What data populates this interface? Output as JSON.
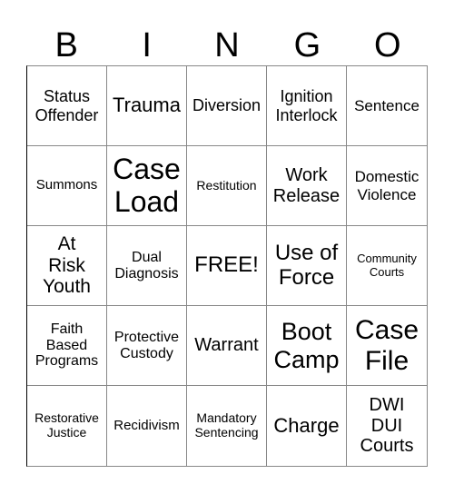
{
  "header": [
    "B",
    "I",
    "N",
    "G",
    "O"
  ],
  "cells": [
    {
      "text": "Status\nOffender",
      "size": 18
    },
    {
      "text": "Trauma",
      "size": 22
    },
    {
      "text": "Diversion",
      "size": 18
    },
    {
      "text": "Ignition\nInterlock",
      "size": 18
    },
    {
      "text": "Sentence",
      "size": 17
    },
    {
      "text": "Summons",
      "size": 15
    },
    {
      "text": "Case\nLoad",
      "size": 32
    },
    {
      "text": "Restitution",
      "size": 14
    },
    {
      "text": "Work\nRelease",
      "size": 20
    },
    {
      "text": "Domestic\nViolence",
      "size": 17
    },
    {
      "text": "At\nRisk\nYouth",
      "size": 21
    },
    {
      "text": "Dual\nDiagnosis",
      "size": 16
    },
    {
      "text": "FREE!",
      "size": 24
    },
    {
      "text": "Use of\nForce",
      "size": 24
    },
    {
      "text": "Community\nCourts",
      "size": 13
    },
    {
      "text": "Faith\nBased\nPrograms",
      "size": 16
    },
    {
      "text": "Protective\nCustody",
      "size": 16
    },
    {
      "text": "Warrant",
      "size": 20
    },
    {
      "text": "Boot\nCamp",
      "size": 27
    },
    {
      "text": "Case\nFile",
      "size": 30
    },
    {
      "text": "Restorative\nJustice",
      "size": 14
    },
    {
      "text": "Recidivism",
      "size": 15
    },
    {
      "text": "Mandatory\nSentencing",
      "size": 14
    },
    {
      "text": "Charge",
      "size": 22
    },
    {
      "text": "DWI\nDUI\nCourts",
      "size": 20
    }
  ]
}
